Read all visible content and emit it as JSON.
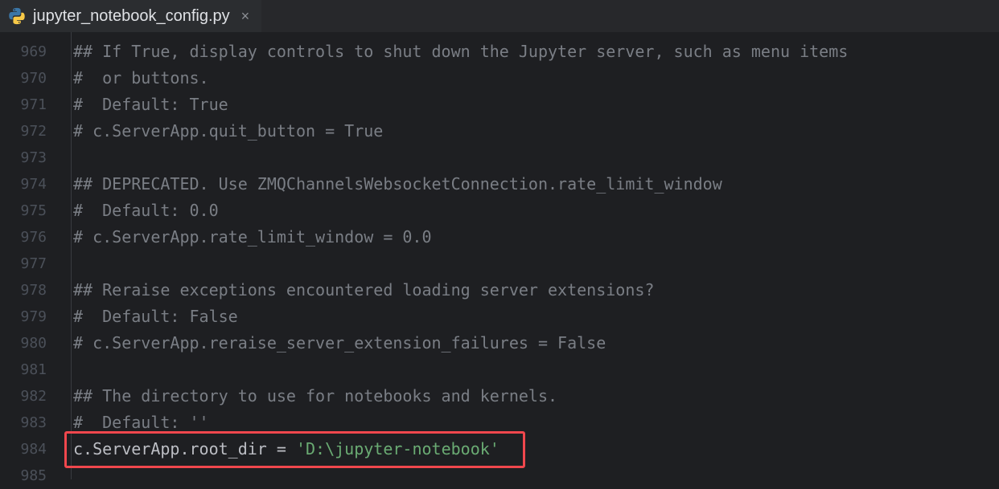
{
  "tab": {
    "title": "jupyter_notebook_config.py",
    "icon": "python-icon",
    "close": "×"
  },
  "lines": [
    {
      "n": "969",
      "t": "## If True, display controls to shut down the Jupyter server, such as menu items"
    },
    {
      "n": "970",
      "t": "#  or buttons."
    },
    {
      "n": "971",
      "t": "#  Default: True"
    },
    {
      "n": "972",
      "t": "# c.ServerApp.quit_button = True"
    },
    {
      "n": "973",
      "t": ""
    },
    {
      "n": "974",
      "t": "## DEPRECATED. Use ZMQChannelsWebsocketConnection.rate_limit_window"
    },
    {
      "n": "975",
      "t": "#  Default: 0.0"
    },
    {
      "n": "976",
      "t": "# c.ServerApp.rate_limit_window = 0.0"
    },
    {
      "n": "977",
      "t": ""
    },
    {
      "n": "978",
      "t": "## Reraise exceptions encountered loading server extensions?"
    },
    {
      "n": "979",
      "t": "#  Default: False"
    },
    {
      "n": "980",
      "t": "# c.ServerApp.reraise_server_extension_failures = False"
    },
    {
      "n": "981",
      "t": ""
    },
    {
      "n": "982",
      "t": "## The directory to use for notebooks and kernels."
    },
    {
      "n": "983",
      "t": "#  Default: ''"
    },
    {
      "n": "984",
      "code": "c.ServerApp.root_dir = ",
      "str": "'D:\\jupyter-notebook'"
    },
    {
      "n": "985",
      "t": ""
    }
  ]
}
